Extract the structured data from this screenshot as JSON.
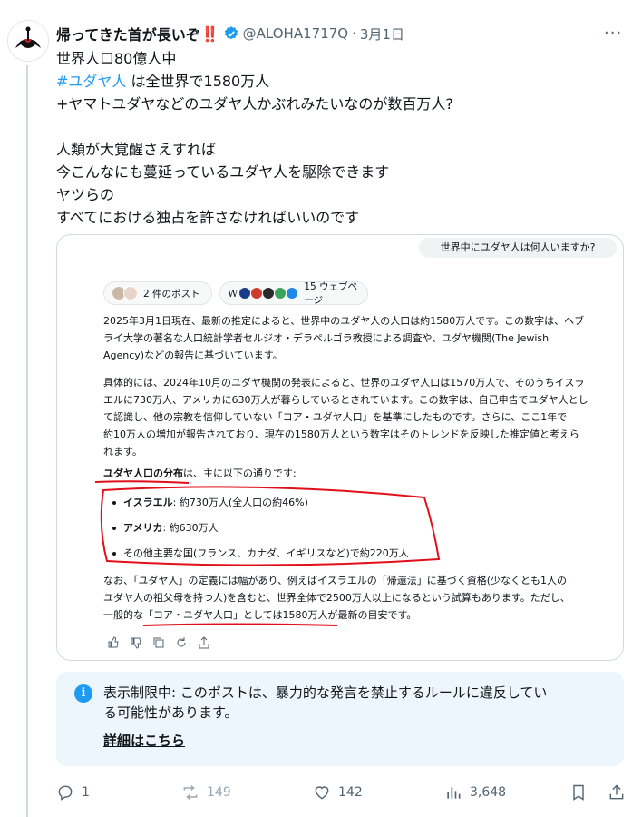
{
  "post": {
    "author_name": "帰ってきた首が長いぞ",
    "author_emoji": "‼️",
    "handle": "@ALOHA1717Q",
    "separator": "·",
    "date": "3月1日",
    "text_line1": "世界人口80億人中",
    "hashtag": "#ユダヤ人",
    "text_line2_rest": " は全世界で1580万人",
    "text_line3": "+ヤマトユダヤなどのユダヤ人かぶれみたいなのが数百万人?",
    "text_line5": "人類が大覚醒さえすれば",
    "text_line6": "今こんなにも蔓延っているユダヤ人を駆除できます",
    "text_line7": "ヤツらの",
    "text_line8": "すべてにおける独占を許さなければいいのです"
  },
  "card": {
    "question": "世界中にユダヤ人は何人いますか?",
    "pill_posts": "2 件のポスト",
    "pill_web": "15 ウェブページ",
    "para1": [
      "2025年3月1日現在、最新の推定によると、世界中のユダヤ人の人口は約1580万人です。この数字は、ヘブ",
      "ライ大学の著名な人口統計学者セルジオ・デラペルゴラ教授による調査や、ユダヤ機関(The Jewish",
      "Agency)などの報告に基づいています。"
    ],
    "para2": [
      "具体的には、2024年10月のユダヤ機関の発表によると、世界のユダヤ人口は1570万人で、そのうちイスラ",
      "エルに730万人、アメリカに630万人が暮らしているとされています。この数字は、自己申告でユダヤ人とし",
      "て認識し、他の宗教を信仰していない「コア・ユダヤ人口」を基準にしたものです。さらに、ここ1年で",
      "約10万人の増加が報告されており、現在の1580万人という数字はそのトレンドを反映した推定値と考えら",
      "れます。"
    ],
    "dist_heading_bold": "ユダヤ人口の分布",
    "dist_heading_rest": "は、主に以下の通りです:",
    "bullets": [
      {
        "bold": "イスラエル",
        "rest": ": 約730万人(全人口の約46%)"
      },
      {
        "bold": "アメリカ",
        "rest": ": 約630万人"
      },
      {
        "bold": "",
        "rest": "その他主要な国(フランス、カナダ、イギリスなど)で約220万人"
      }
    ],
    "para3": [
      "なお、「ユダヤ人」の定義には幅があり、例えばイスラエルの「帰還法」に基づく資格(少なくとも1人の",
      "ユダヤ人の祖父母を持つ人)を含むと、世界全体で2500万人以上になるという試算もあります。ただし、",
      "一般的な「コア・ユダヤ人口」としては1580万人が最新の目安です。"
    ]
  },
  "notice": {
    "line1": "表示制限中: このポストは、暴力的な発言を禁止するルールに違反してい",
    "line2": "る可能性があります。",
    "link": "詳細はこちら"
  },
  "actions": {
    "replies": "1",
    "reposts": "149",
    "likes": "142",
    "views": "3,648"
  },
  "colors": {
    "accent": "#1d9bf0",
    "annotation_red": "#e0101a",
    "notice_bg": "#eef6fd"
  }
}
